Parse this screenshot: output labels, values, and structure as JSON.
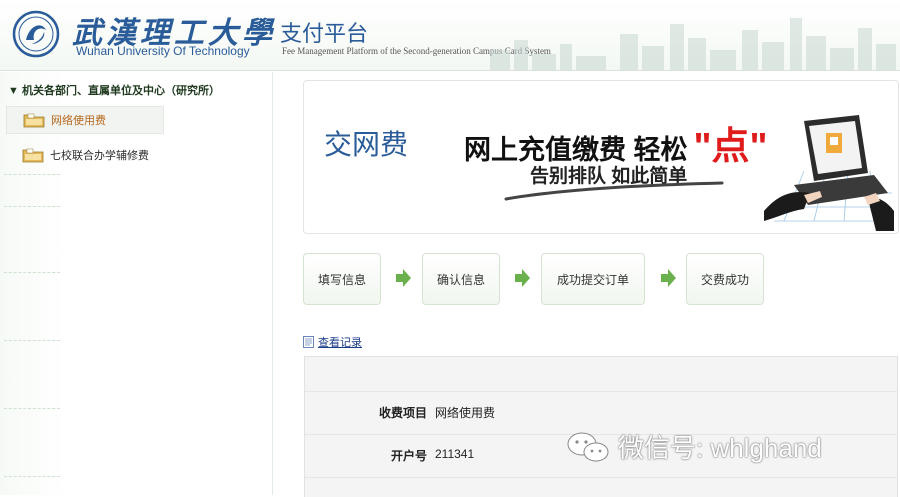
{
  "header": {
    "university_cn": "武漢理工大學",
    "university_en": "Wuhan University Of Technology",
    "platform_cn": "支付平台",
    "platform_en": "Fee Management Platform of the Second-generation Campus Card System"
  },
  "sidebar": {
    "heading": "▼ 机关各部门、直属单位及中心（研究所）",
    "items": [
      {
        "label": "网络使用费",
        "active": true
      },
      {
        "label": "七校联合办学辅修费",
        "active": false
      }
    ]
  },
  "banner": {
    "title": "交网费",
    "slogan": "网上充值缴费 轻松",
    "slogan_highlight": "\"点\"",
    "subslogan": "告别排队 如此简单"
  },
  "steps": [
    {
      "label": "填写信息"
    },
    {
      "label": "确认信息"
    },
    {
      "label": "成功提交订单"
    },
    {
      "label": "交费成功"
    }
  ],
  "record_link": "查看记录",
  "form": {
    "rows": [
      {
        "label": "收费项目",
        "value": "网络使用费"
      },
      {
        "label": "开户号",
        "value": "211341"
      }
    ]
  },
  "watermark": "微信号: whlghand",
  "colors": {
    "brand_blue": "#2a5c9a",
    "accent_green": "#6ab04c",
    "highlight_red": "#e01b1b",
    "active_orange": "#b5671b"
  }
}
